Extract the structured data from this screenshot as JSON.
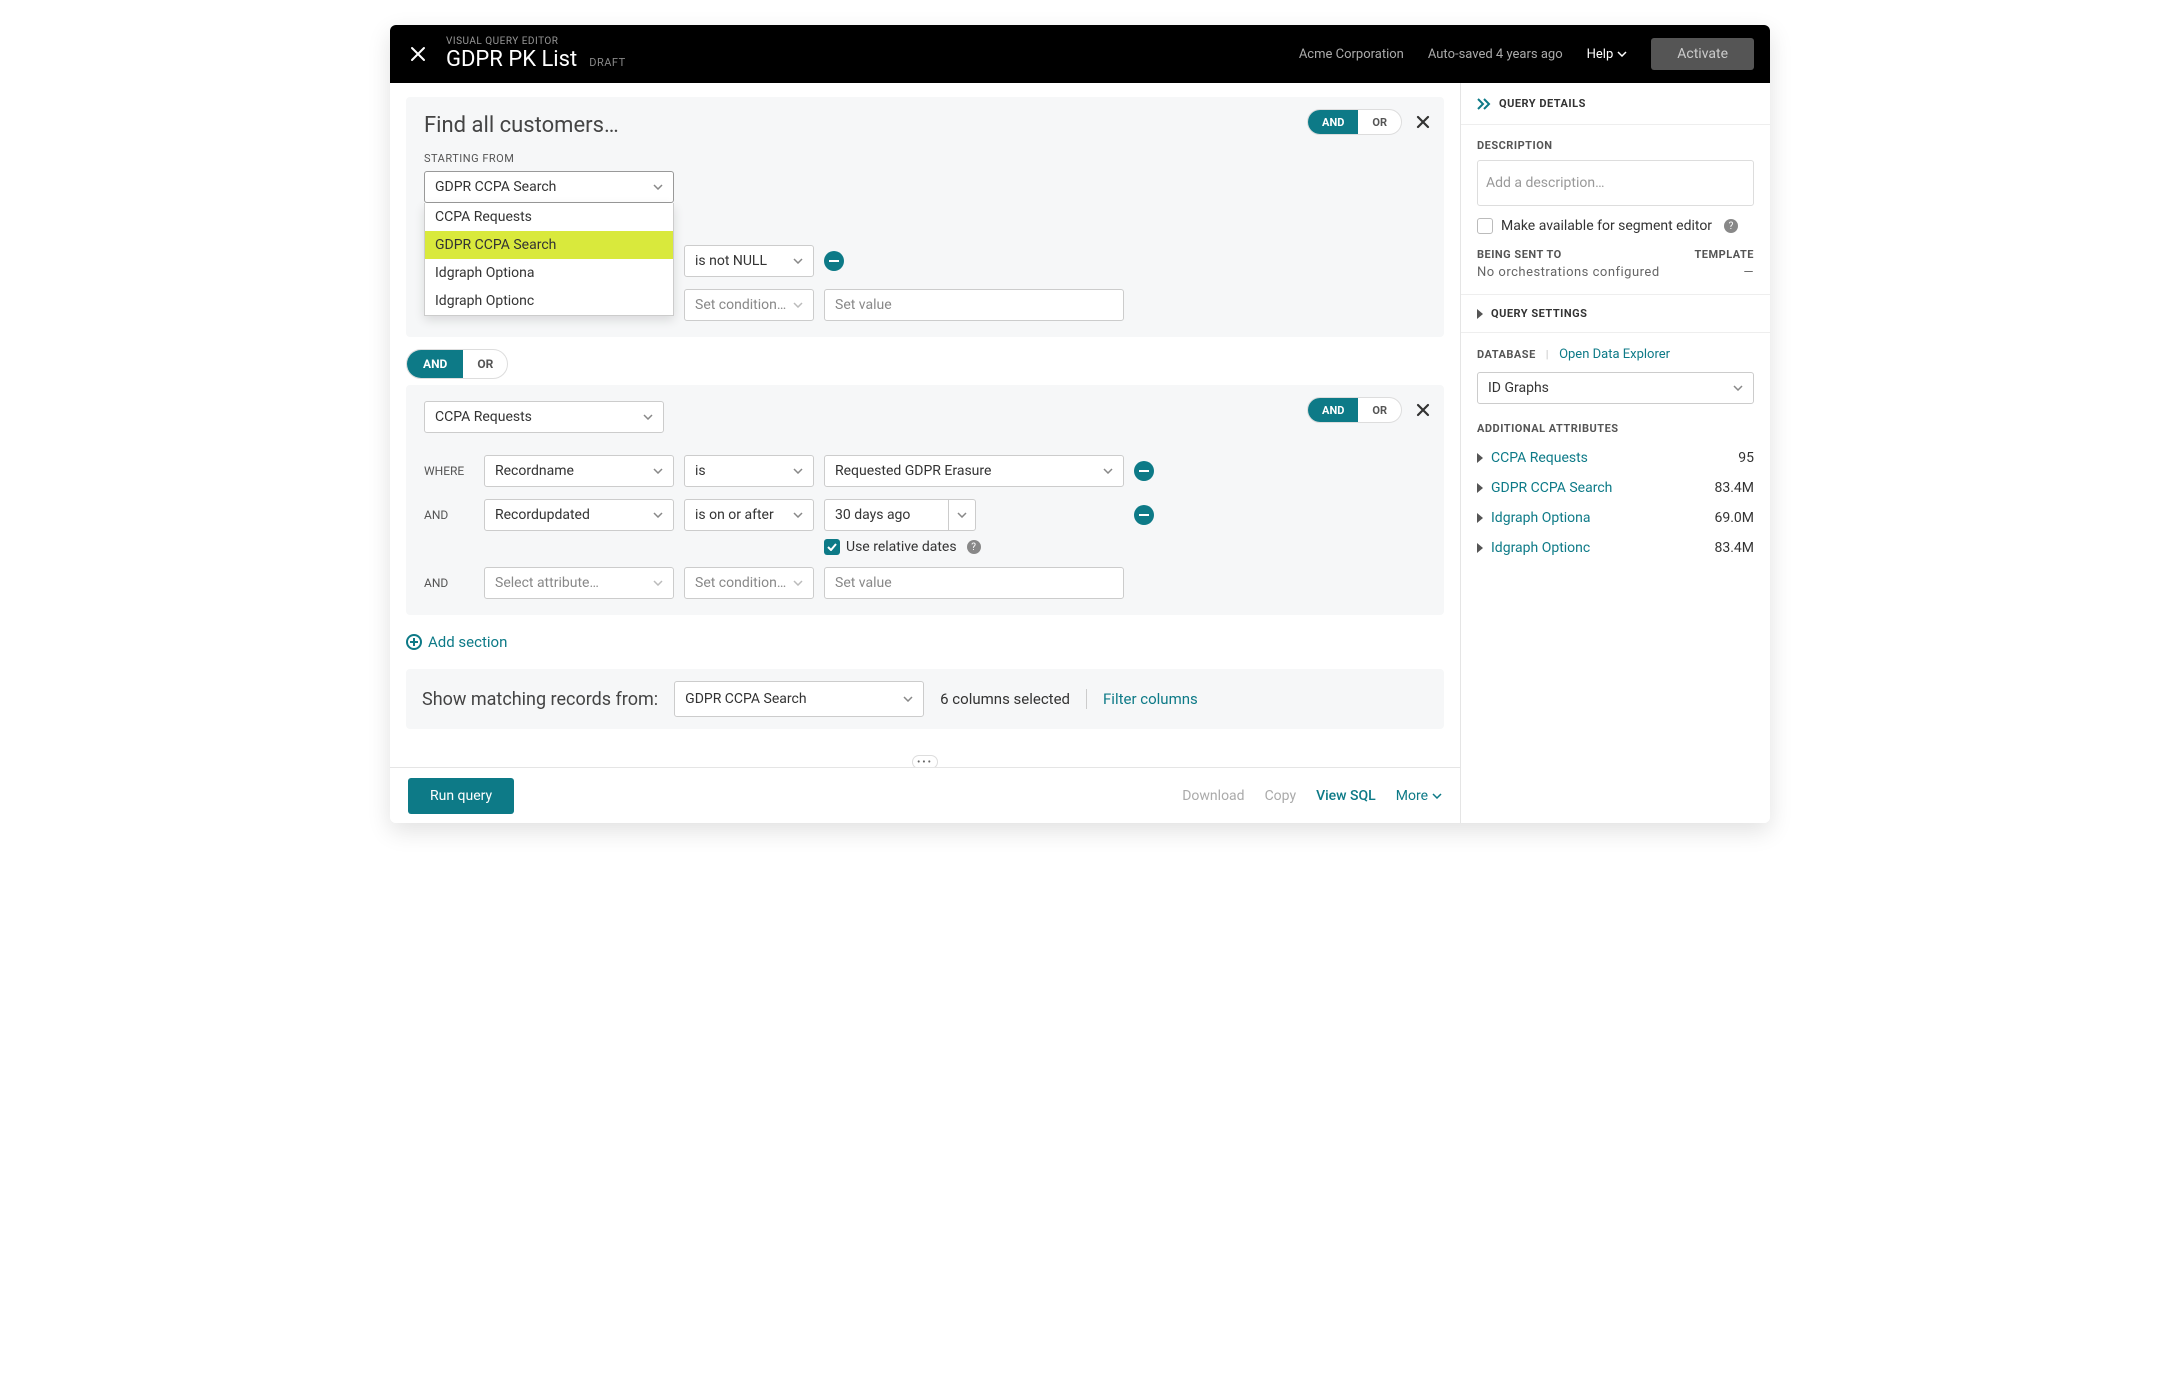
{
  "topbar": {
    "overline": "VISUAL QUERY EDITOR",
    "title": "GDPR PK List",
    "status": "DRAFT",
    "org": "Acme Corporation",
    "saved": "Auto-saved 4 years ago",
    "help": "Help",
    "activate": "Activate"
  },
  "editor": {
    "find_heading": "Find all customers…",
    "starting_from_label": "STARTING FROM",
    "and_label": "AND",
    "or_label": "OR",
    "where_label": "WHERE",
    "select_attribute_ph": "Select attribute…",
    "set_condition_ph": "Set condition…",
    "set_value_ph": "Set value",
    "add_section": "Add section",
    "use_relative_dates": "Use relative dates"
  },
  "block1": {
    "source_selected": "GDPR CCPA Search",
    "dropdown_items": [
      "CCPA Requests",
      "GDPR CCPA Search",
      "Idgraph Optiona",
      "Idgraph Optionc"
    ],
    "cond1": "is not NULL"
  },
  "block2": {
    "source_selected": "CCPA Requests",
    "r1_attr": "Recordname",
    "r1_cond": "is",
    "r1_val": "Requested GDPR Erasure",
    "r2_attr": "Recordupdated",
    "r2_cond": "is on or after",
    "r2_val": "30 days ago"
  },
  "showbar": {
    "label": "Show matching records from:",
    "selected": "GDPR CCPA Search",
    "columns_text": "6 columns selected",
    "filter_link": "Filter columns"
  },
  "footer": {
    "run": "Run query",
    "download": "Download",
    "copy": "Copy",
    "view_sql": "View SQL",
    "more": "More"
  },
  "sidebar": {
    "query_details": "QUERY DETAILS",
    "description_label": "DESCRIPTION",
    "description_ph": "Add a description…",
    "segment_editor": "Make available for segment editor",
    "being_sent_to": "BEING SENT TO",
    "template": "TEMPLATE",
    "no_orch": "No orchestrations configured",
    "template_dash": "—",
    "query_settings": "QUERY SETTINGS",
    "database_label": "DATABASE",
    "open_explorer": "Open Data Explorer",
    "db_selected": "ID Graphs",
    "additional_attrs": "ADDITIONAL ATTRIBUTES",
    "attrs": [
      {
        "name": "CCPA Requests",
        "count": "95"
      },
      {
        "name": "GDPR CCPA Search",
        "count": "83.4M"
      },
      {
        "name": "Idgraph Optiona",
        "count": "69.0M"
      },
      {
        "name": "Idgraph Optionc",
        "count": "83.4M"
      }
    ]
  }
}
